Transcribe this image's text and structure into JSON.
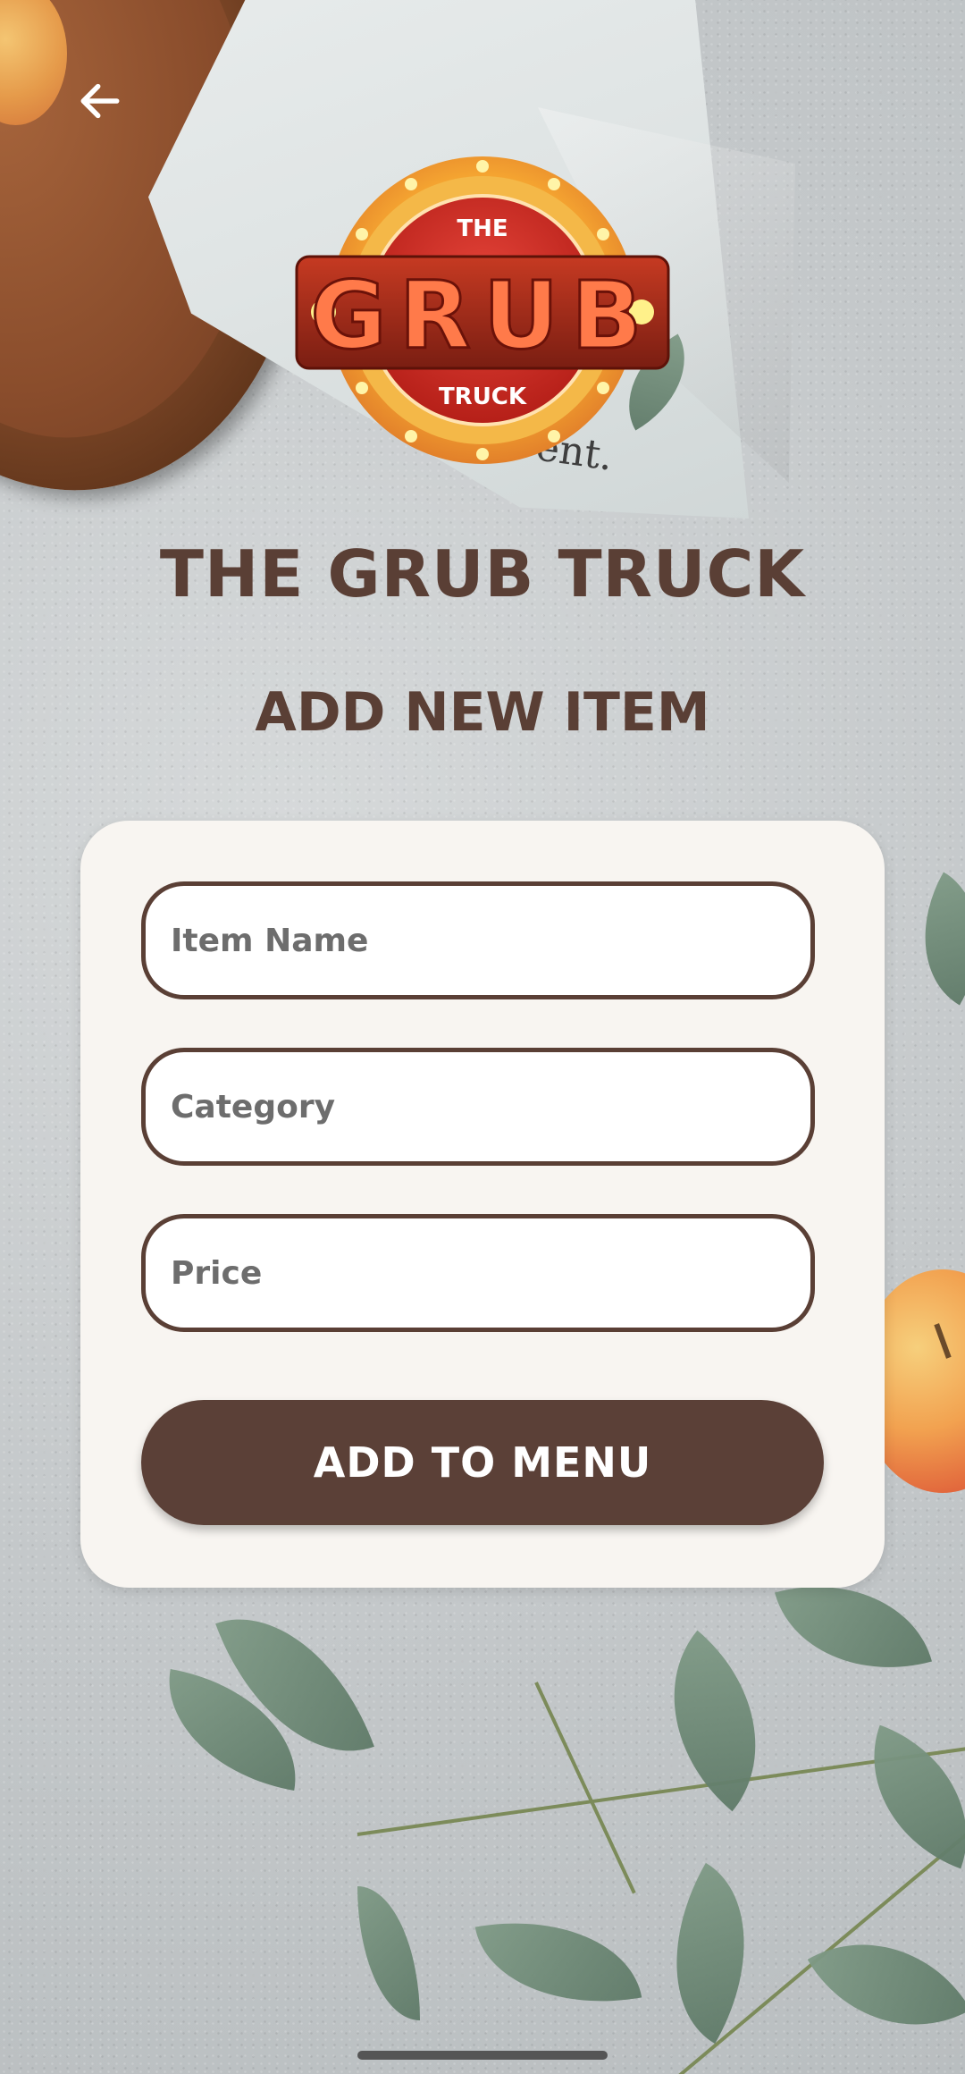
{
  "header": {
    "back_icon": "arrow-left-icon",
    "logo": {
      "text_top": "THE",
      "text_main": "GRUB",
      "text_bottom": "TRUCK"
    }
  },
  "brand": {
    "title": "THE GRUB TRUCK"
  },
  "page": {
    "title": "ADD NEW ITEM"
  },
  "form": {
    "item_name": {
      "value": "",
      "placeholder": "Item Name"
    },
    "category": {
      "value": "",
      "placeholder": "Category"
    },
    "price": {
      "value": "",
      "placeholder": "Price"
    },
    "submit_label": "ADD TO MENU"
  },
  "background": {
    "napkin_text": "ent."
  },
  "colors": {
    "primary": "#5b4037",
    "card": "#f8f5f1",
    "logo_red": "#c8281e",
    "logo_gold": "#f2a23a"
  }
}
